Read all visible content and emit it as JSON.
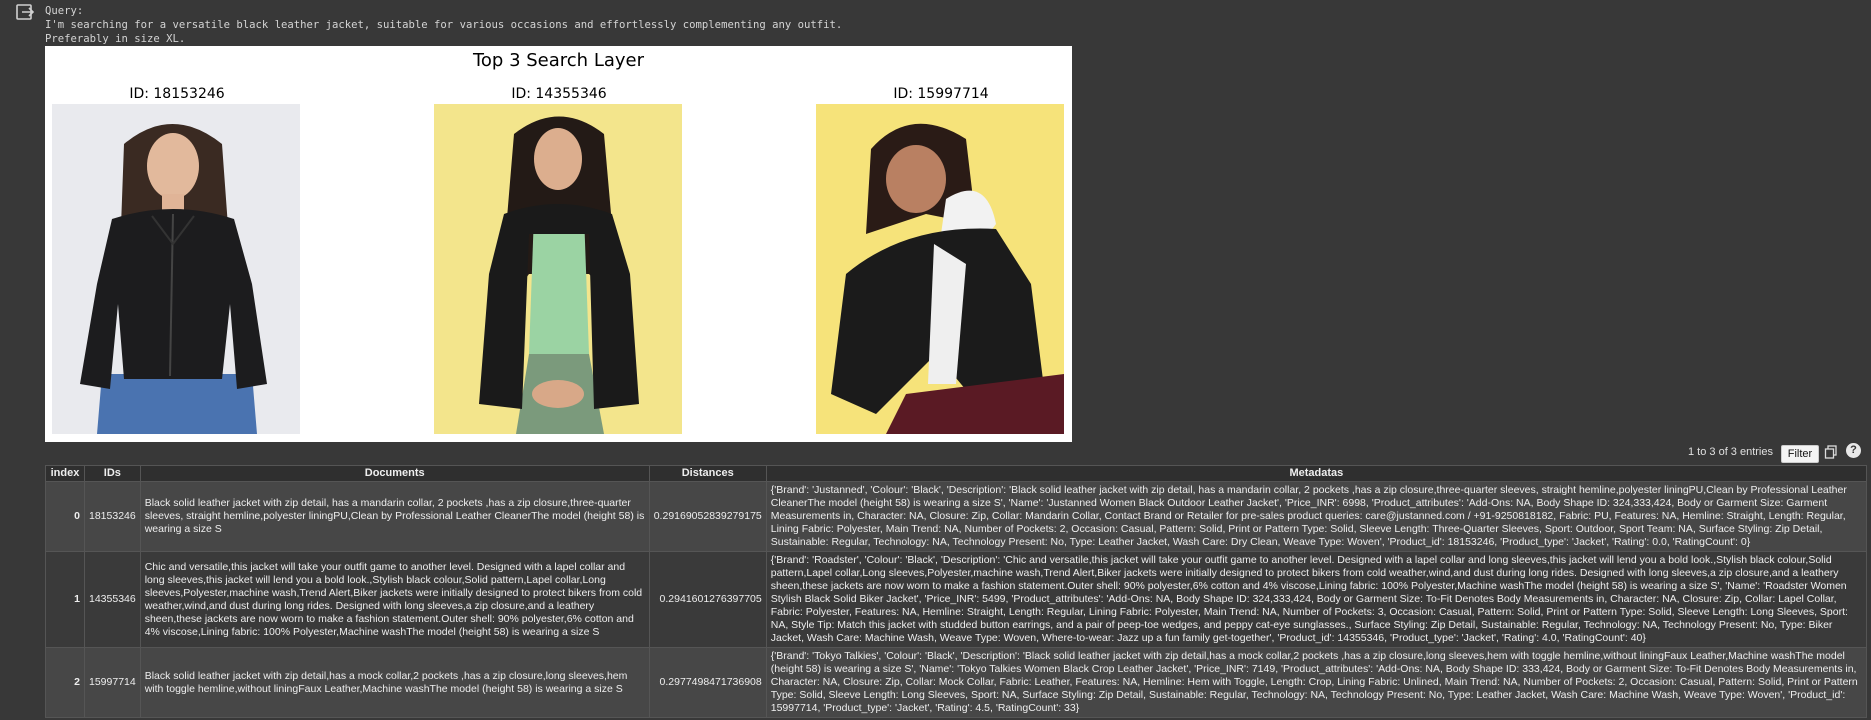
{
  "cell_output": {
    "query_label": "Query:",
    "query_line1": "I'm searching for a versatile black leather jacket, suitable for various occasions and effortlessly complementing any outfit.",
    "query_line2": "Preferably in size XL."
  },
  "figure": {
    "title": "Top 3 Search Layer",
    "panels": [
      {
        "id_label": "ID: 18153246",
        "photo_bg": "#e9eaee"
      },
      {
        "id_label": "ID: 14355346",
        "photo_bg": "#f3e58c"
      },
      {
        "id_label": "ID: 15997714",
        "photo_bg": "#f6e37a"
      }
    ]
  },
  "table_toolbar": {
    "entries_text": "1 to 3 of 3 entries",
    "filter_label": "Filter",
    "help_label": "?"
  },
  "table": {
    "headers": [
      "index",
      "IDs",
      "Documents",
      "Distances",
      "Metadatas"
    ],
    "rows": [
      {
        "index": "0",
        "id": "18153246",
        "document": "Black solid leather jacket with zip detail, has a mandarin collar, 2 pockets ,has a zip closure,three-quarter sleeves, straight hemline,polyester liningPU,Clean by Professional Leather CleanerThe model (height 58) is wearing a size S",
        "distance": "0.29169052839279175",
        "metadata": "{'Brand': 'Justanned', 'Colour': 'Black', 'Description': 'Black solid leather jacket with zip detail, has a mandarin collar, 2 pockets ,has a zip closure,three-quarter sleeves, straight hemline,polyester liningPU,Clean by Professional Leather CleanerThe model (height 58) is wearing a size S', 'Name': 'Justanned Women Black Outdoor Leather Jacket', 'Price_INR': 6998, 'Product_attributes': 'Add-Ons: NA, Body Shape ID: 324,333,424, Body or Garment Size: Garment Measurements in, Character: NA, Closure: Zip, Collar: Mandarin Collar, Contact Brand or Retailer for pre-sales product queries: care@justanned.com / +91-9250818182, Fabric: PU, Features: NA, Hemline: Straight, Length: Regular, Lining Fabric: Polyester, Main Trend: NA, Number of Pockets: 2, Occasion: Casual, Pattern: Solid, Print or Pattern Type: Solid, Sleeve Length: Three-Quarter Sleeves, Sport: Outdoor, Sport Team: NA, Surface Styling: Zip Detail, Sustainable: Regular, Technology: NA, Technology Present: No, Type: Leather Jacket, Wash Care: Dry Clean, Weave Type: Woven', 'Product_id': 18153246, 'Product_type': 'Jacket', 'Rating': 0.0, 'RatingCount': 0}"
      },
      {
        "index": "1",
        "id": "14355346",
        "document": "Chic and versatile,this jacket will take your outfit game to another level. Designed with a lapel collar and long sleeves,this jacket will lend you a bold look.,Stylish black colour,Solid pattern,Lapel collar,Long sleeves,Polyester,machine wash,Trend Alert,Biker jackets were initially designed to protect bikers from cold weather,wind,and dust during long rides. Designed with long sleeves,a zip closure,and a leathery sheen,these jackets are now worn to make a fashion statement.Outer shell: 90% polyester,6% cotton and 4% viscose,Lining fabric: 100% Polyester,Machine washThe model (height 58) is wearing a size S",
        "distance": "0.2941601276397705",
        "metadata": "{'Brand': 'Roadster', 'Colour': 'Black', 'Description': 'Chic and versatile,this jacket will take your outfit game to another level. Designed with a lapel collar and long sleeves,this jacket will lend you a bold look.,Stylish black colour,Solid pattern,Lapel collar,Long sleeves,Polyester,machine wash,Trend Alert,Biker jackets were initially designed to protect bikers from cold weather,wind,and dust during long rides. Designed with long sleeves,a zip closure,and a leathery sheen,these jackets are now worn to make a fashion statement.Outer shell: 90% polyester,6% cotton and 4% viscose,Lining fabric: 100% Polyester,Machine washThe model (height 58) is wearing a size S', 'Name': 'Roadster Women Stylish Black Solid Biker Jacket', 'Price_INR': 5499, 'Product_attributes': 'Add-Ons: NA, Body Shape ID: 324,333,424, Body or Garment Size: To-Fit Denotes Body Measurements in, Character: NA, Closure: Zip, Collar: Lapel Collar, Fabric: Polyester, Features: NA, Hemline: Straight, Length: Regular, Lining Fabric: Polyester, Main Trend: NA, Number of Pockets: 3, Occasion: Casual, Pattern: Solid, Print or Pattern Type: Solid, Sleeve Length: Long Sleeves, Sport: NA, Style Tip: Match this jacket with studded button earrings, and a pair of peep-toe wedges, and peppy cat-eye sunglasses., Surface Styling: Zip Detail, Sustainable: Regular, Technology: NA, Technology Present: No, Type: Biker Jacket, Wash Care: Machine Wash, Weave Type: Woven, Where-to-wear: Jazz up a fun family get-together', 'Product_id': 14355346, 'Product_type': 'Jacket', 'Rating': 4.0, 'RatingCount': 40}"
      },
      {
        "index": "2",
        "id": "15997714",
        "document": "Black solid leather jacket with zip detail,has a mock collar,2 pockets ,has a zip closure,long sleeves,hem with toggle hemline,without liningFaux Leather,Machine washThe model (height 58) is wearing a size S",
        "distance": "0.2977498471736908",
        "metadata": "{'Brand': 'Tokyo Talkies', 'Colour': 'Black', 'Description': 'Black solid leather jacket with zip detail,has a mock collar,2 pockets ,has a zip closure,long sleeves,hem with toggle hemline,without liningFaux Leather,Machine washThe model (height 58) is wearing a size S', 'Name': 'Tokyo Talkies Women Black Crop Leather Jacket', 'Price_INR': 7149, 'Product_attributes': 'Add-Ons: NA, Body Shape ID: 333,424, Body or Garment Size: To-Fit Denotes Body Measurements in, Character: NA, Closure: Zip, Collar: Mock Collar, Fabric: Leather, Features: NA, Hemline: Hem with Toggle, Length: Crop, Lining Fabric: Unlined, Main Trend: NA, Number of Pockets: 2, Occasion: Casual, Pattern: Solid, Print or Pattern Type: Solid, Sleeve Length: Long Sleeves, Sport: NA, Surface Styling: Zip Detail, Sustainable: Regular, Technology: NA, Technology Present: No, Type: Leather Jacket, Wash Care: Machine Wash, Weave Type: Woven', 'Product_id': 15997714, 'Product_type': 'Jacket', 'Rating': 4.5, 'RatingCount': 33}"
      }
    ]
  }
}
